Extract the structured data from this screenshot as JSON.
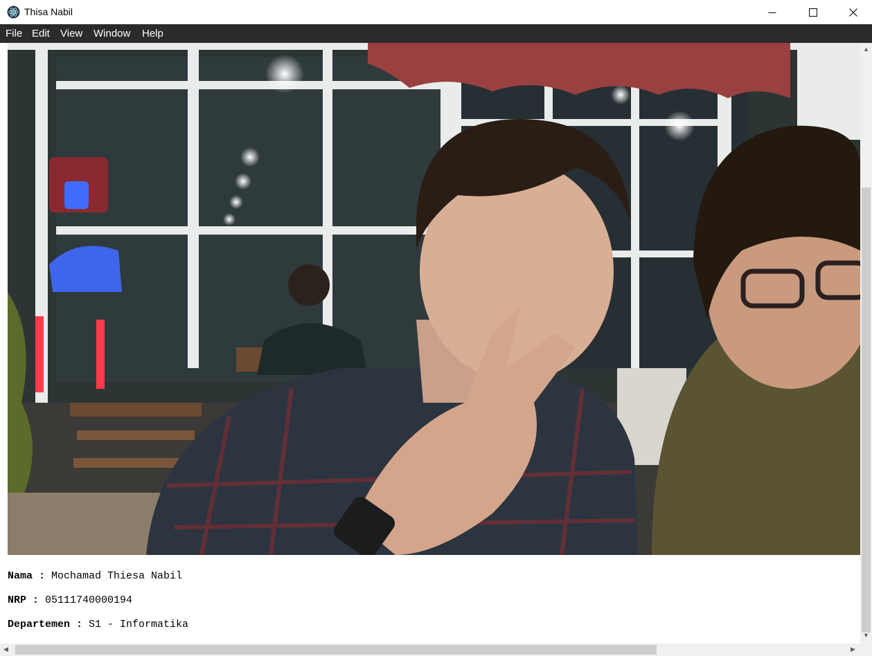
{
  "window": {
    "title": "Thisa Nabil",
    "icon": "electron-atom-icon"
  },
  "menu": {
    "items": [
      "File",
      "Edit",
      "View",
      "Window",
      "Help"
    ]
  },
  "info": {
    "nama_label": "Nama",
    "nama_value": "Mochamad Thiesa Nabil",
    "nrp_label": "NRP",
    "nrp_value": "05111740000194",
    "departemen_label": "Departemen",
    "departemen_value": "S1 - Informatika",
    "separator": " : "
  },
  "colors": {
    "menubar_bg": "#2b2b2b",
    "menubar_text": "#ffffff",
    "scroll_track": "#f0f0f0",
    "scroll_thumb": "#cdcdcd"
  }
}
